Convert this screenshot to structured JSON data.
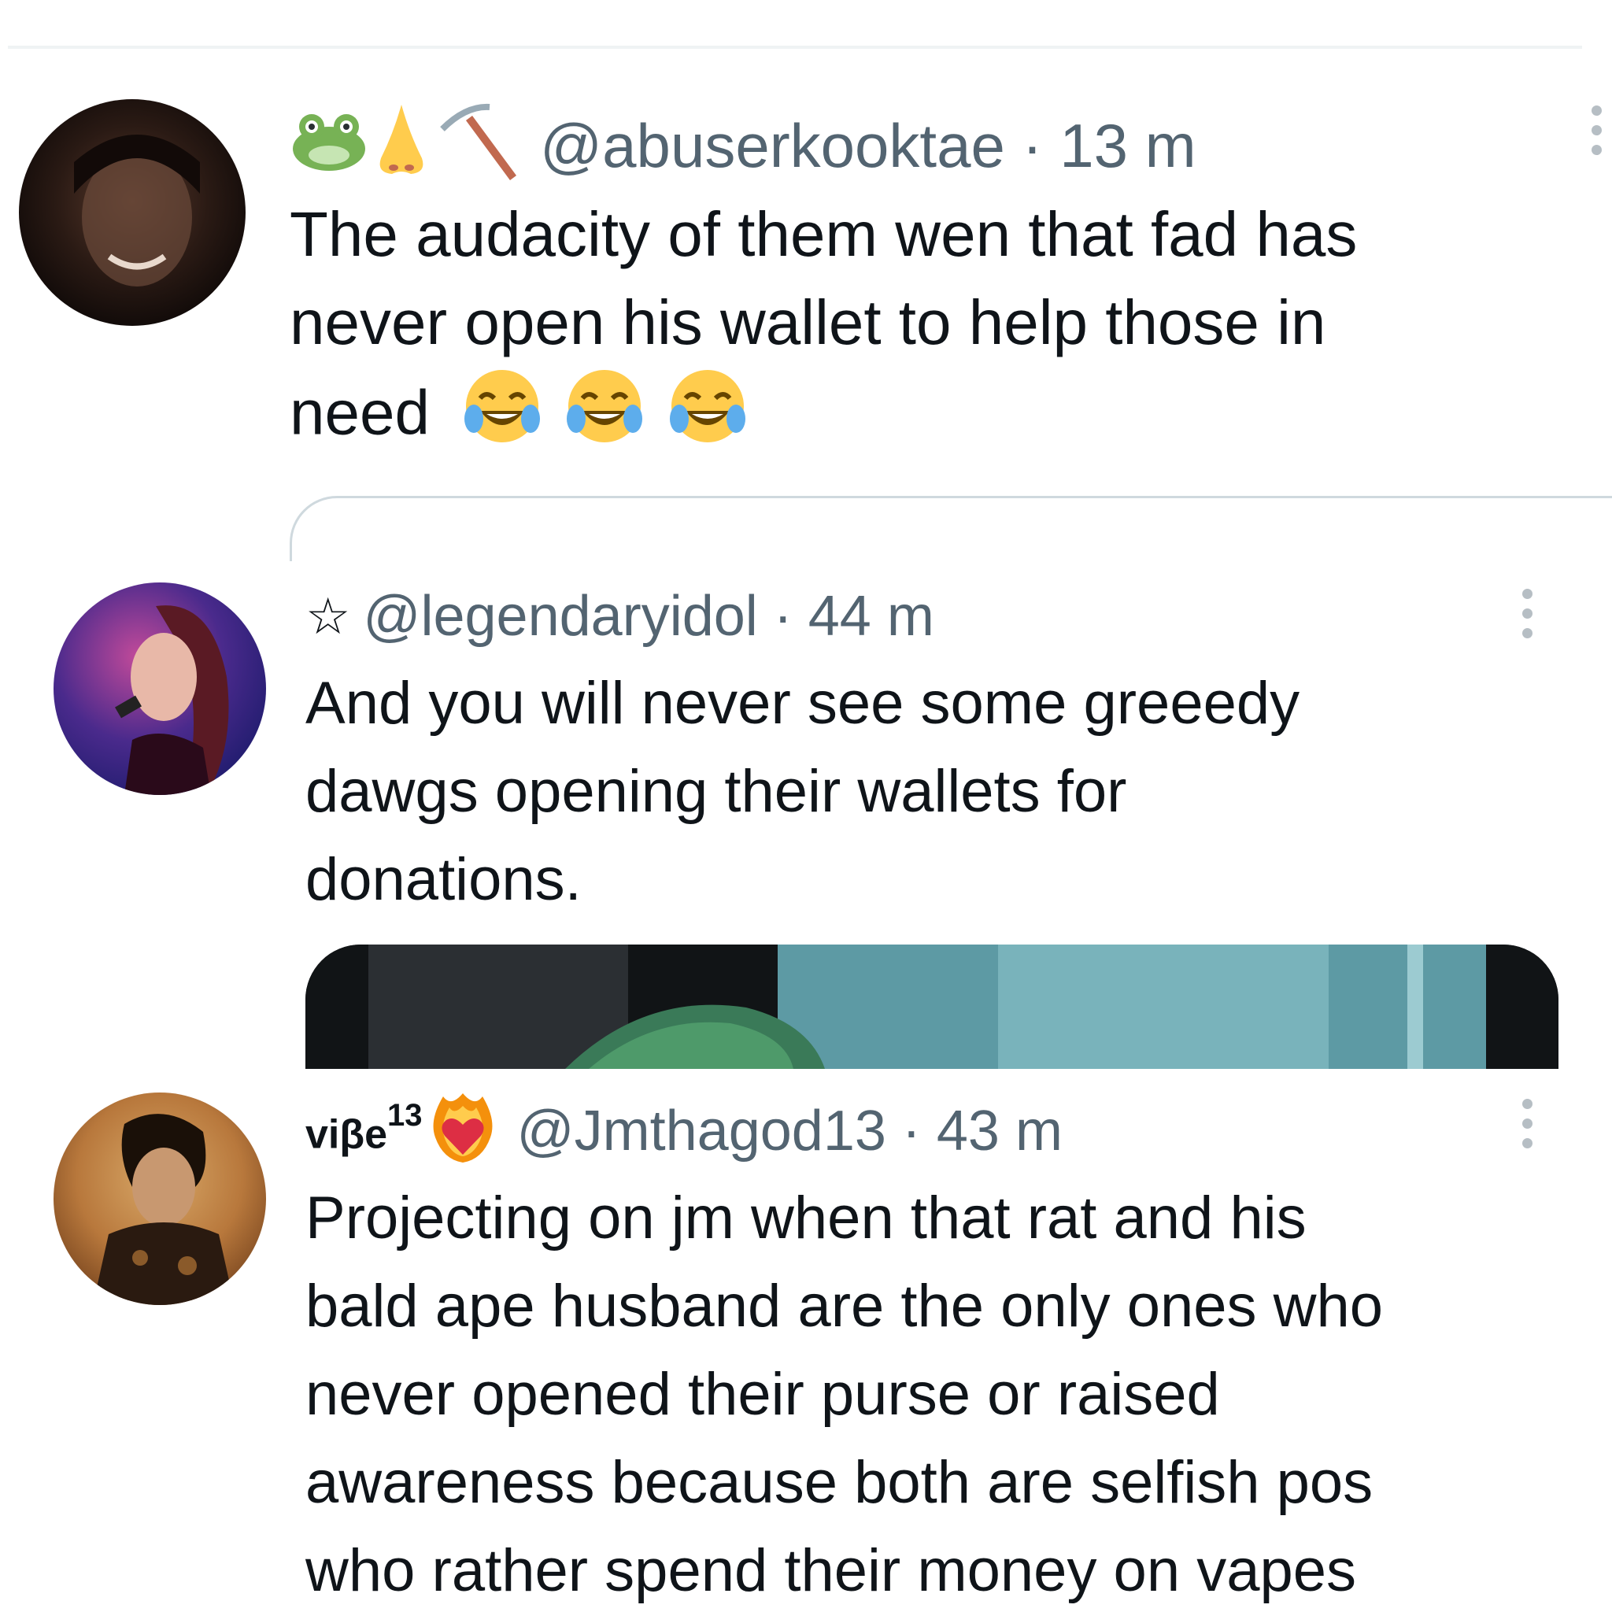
{
  "tweets": [
    {
      "name_emojis": [
        "frog-emoji",
        "nose-emoji",
        "pick-emoji"
      ],
      "handle": "@abuserkooktae",
      "time": "13 m",
      "text_lines": [
        "The audacity of them wen that fad has",
        "never open his wallet to help those in",
        "need"
      ],
      "trailing_emojis": [
        "😂",
        "😂",
        "😂"
      ]
    },
    {
      "name_prefix": "☆",
      "handle": "@legendaryidol",
      "time": "44 m",
      "text_lines": [
        "And you will never see some greeedy",
        "dawgs opening their wallets for",
        "donations."
      ]
    },
    {
      "display_name": "viβe",
      "display_sup": "13",
      "handle": "@Jmthagod13",
      "time": "43 m",
      "text_lines": [
        "Projecting on jm when that rat and his",
        "bald ape husband are the only ones who",
        "never opened their purse or raised",
        "awareness because both are selfish pos",
        "who rather spend their money on vapes"
      ]
    }
  ],
  "separator": " · ",
  "colors": {
    "text": "#0f1419",
    "secondary": "#536471",
    "divider": "#eff3f4"
  }
}
